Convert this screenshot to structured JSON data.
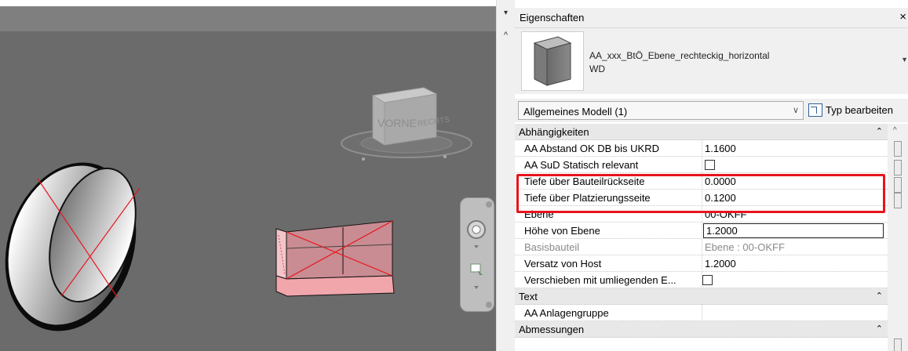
{
  "viewport": {
    "viewcube_front": "VORNE",
    "viewcube_right": "RECHTS"
  },
  "scrollbar": {
    "down_arrow": "▾",
    "up_arrow": "^"
  },
  "properties": {
    "title": "Eigenschaften",
    "close": "×",
    "type_name_line1": "AA_xxx_BtÖ_Ebene_rechteckig_horizontal",
    "type_name_line2": "WD",
    "type_dropdown_icon": "▼",
    "selector_label": "Allgemeines Modell (1)",
    "selector_chevron": "∨",
    "edit_type_label": "Typ bearbeiten",
    "groups": [
      {
        "label": "Abhängigkeiten",
        "collapse": "⌃"
      },
      {
        "label": "Text",
        "collapse": "⌃"
      },
      {
        "label": "Abmessungen",
        "collapse": "⌃"
      }
    ],
    "rows": [
      {
        "key": "AA Abstand OK DB bis UKRD",
        "value": "1.1600"
      },
      {
        "key": "AA SuD Statisch relevant",
        "value": ""
      },
      {
        "key": "Tiefe über Bauteilrückseite",
        "value": "0.0000"
      },
      {
        "key": "Tiefe über Platzierungsseite",
        "value": "0.1200"
      },
      {
        "key": "Ebene",
        "value": "00-OKFF"
      },
      {
        "key": "Höhe von Ebene",
        "value": "1.2000"
      },
      {
        "key": "Basisbauteil",
        "value": "Ebene : 00-OKFF"
      },
      {
        "key": "Versatz von Host",
        "value": "1.2000"
      },
      {
        "key": "Verschieben mit umliegenden E...",
        "value": ""
      },
      {
        "key": "AA Anlagengruppe",
        "value": ""
      }
    ]
  },
  "colors": {
    "highlight": "#e8141c",
    "viewport_bg": "#6b6b6b",
    "opening_fill": "#e9a3a8"
  }
}
